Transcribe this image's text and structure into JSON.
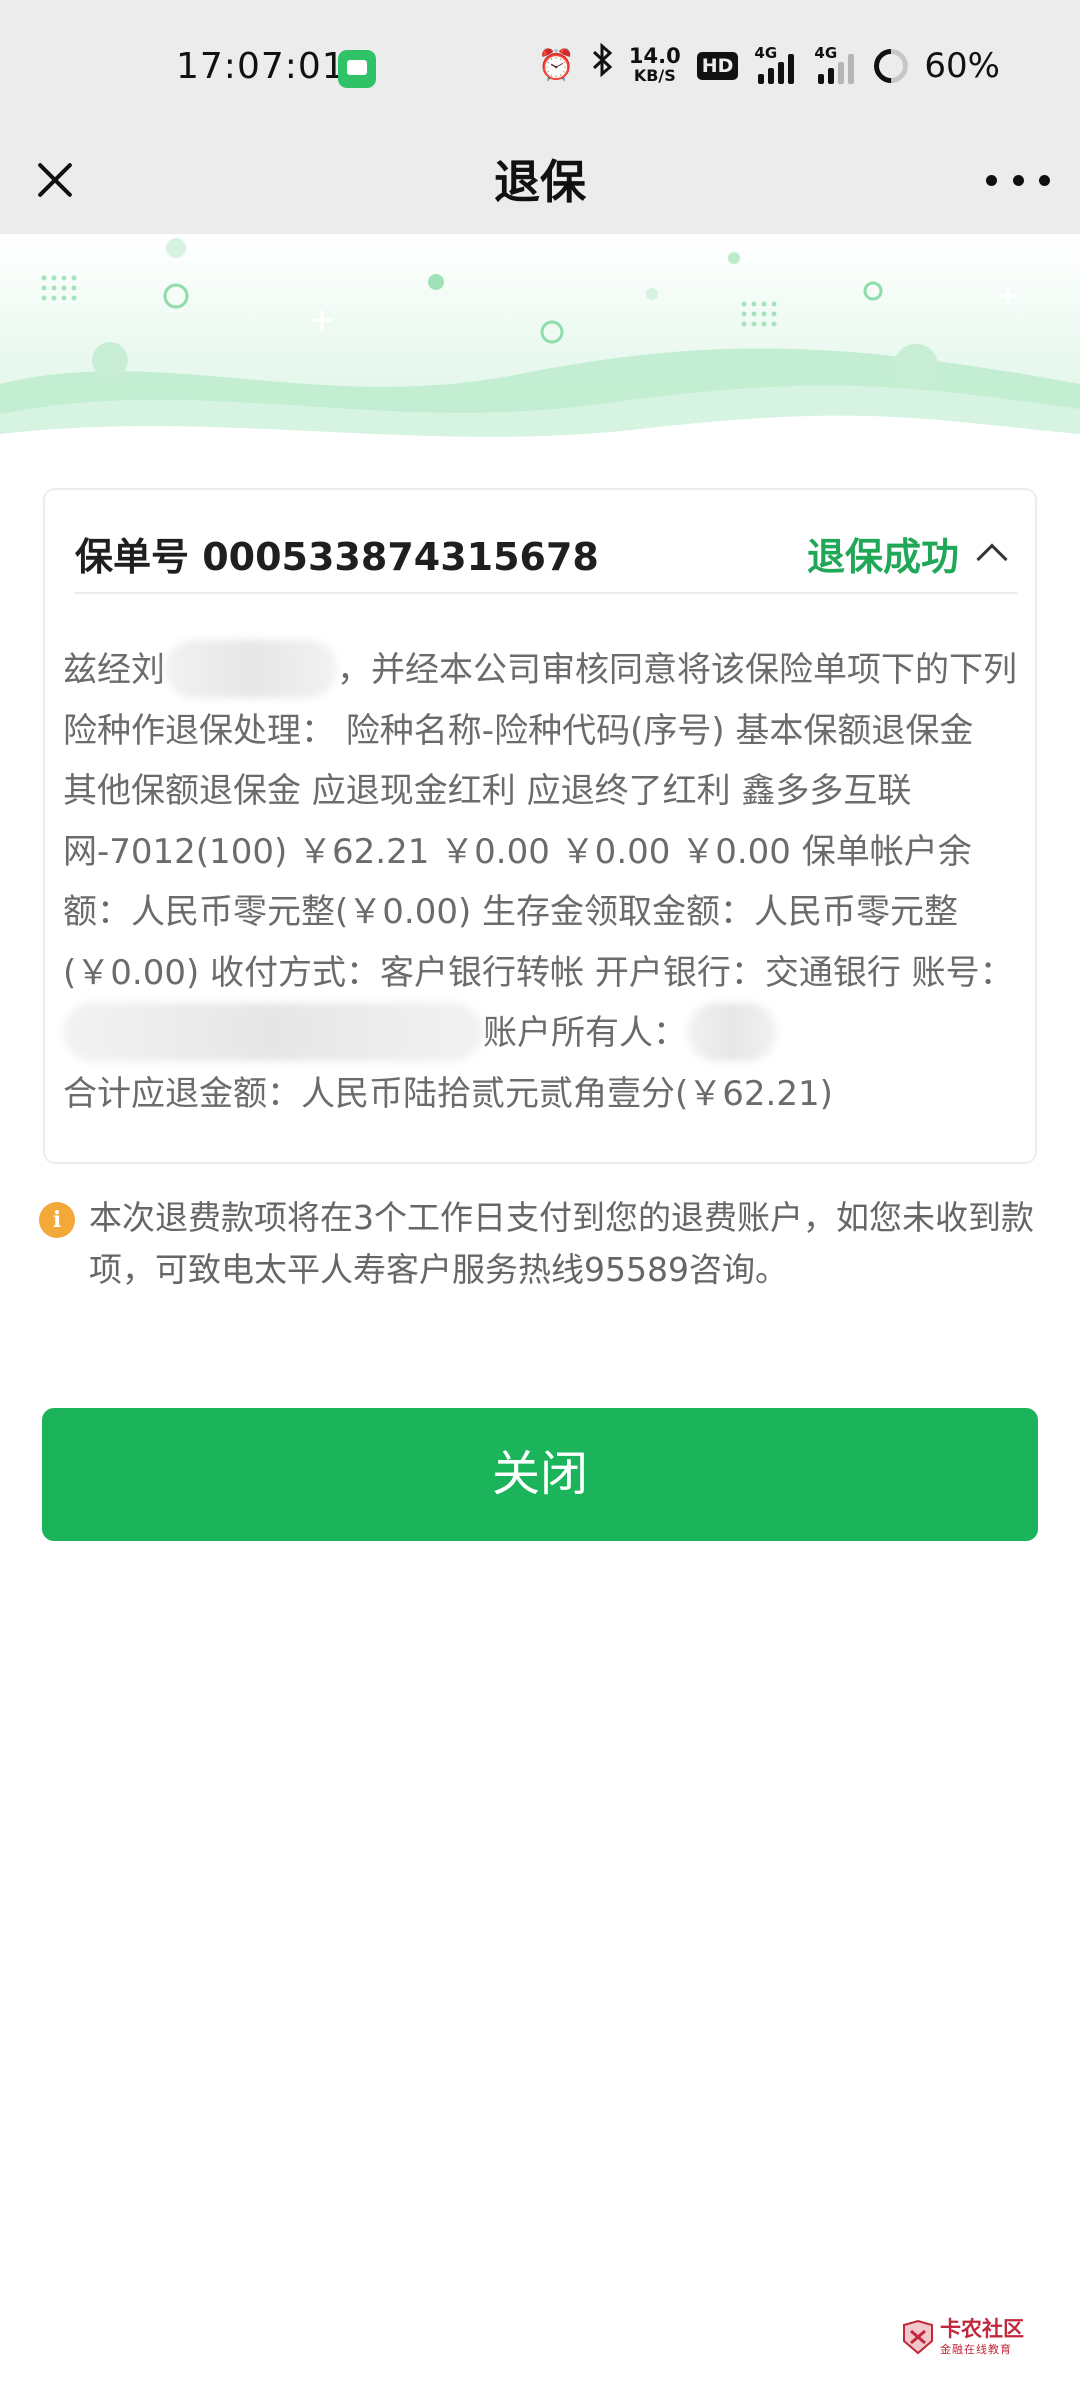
{
  "status_bar": {
    "time": "17:07:01",
    "speed_value": "14.0",
    "speed_unit": "KB/S",
    "hd_label": "HD",
    "network_1": "4G",
    "network_2": "4G",
    "battery": "60%"
  },
  "nav": {
    "title": "退保"
  },
  "card": {
    "policy_label": "保单号 000533874315678",
    "status": "退保成功",
    "body": {
      "p1": "兹经刘",
      "p2": "，并经本公司审核同意将该保险单项下的下列险种作退保处理： 险种名称-险种代码(序号) 基本保额退保金 其他保额退保金 应退现金红利 应退终了红利 鑫多多互联网-7012(100) ￥62.21 ￥0.00 ￥0.00 ￥0.00 保单帐户余额：人民币零元整(￥0.00) 生存金领取金额：人民币零元整(￥0.00) 收付方式：客户银行转帐 开户银行：交通银行 账号：",
      "p3": "账户所有人：",
      "p4": "合计应退金额：人民币陆拾贰元贰角壹分(￥62.21)"
    }
  },
  "notice": {
    "icon": "info-icon",
    "text": "本次退费款项将在3个工作日支付到您的退费账户，如您未收到款项，可致电太平人寿客户服务热线95589咨询。"
  },
  "button": {
    "label": "关闭",
    "color": "#1bb45a"
  },
  "watermark": {
    "main": "卡农社区",
    "sub": "金融在线教育"
  },
  "colors": {
    "accent": "#20a858",
    "nav_bg": "#ececec",
    "notice_icon": "#f4a83a"
  }
}
